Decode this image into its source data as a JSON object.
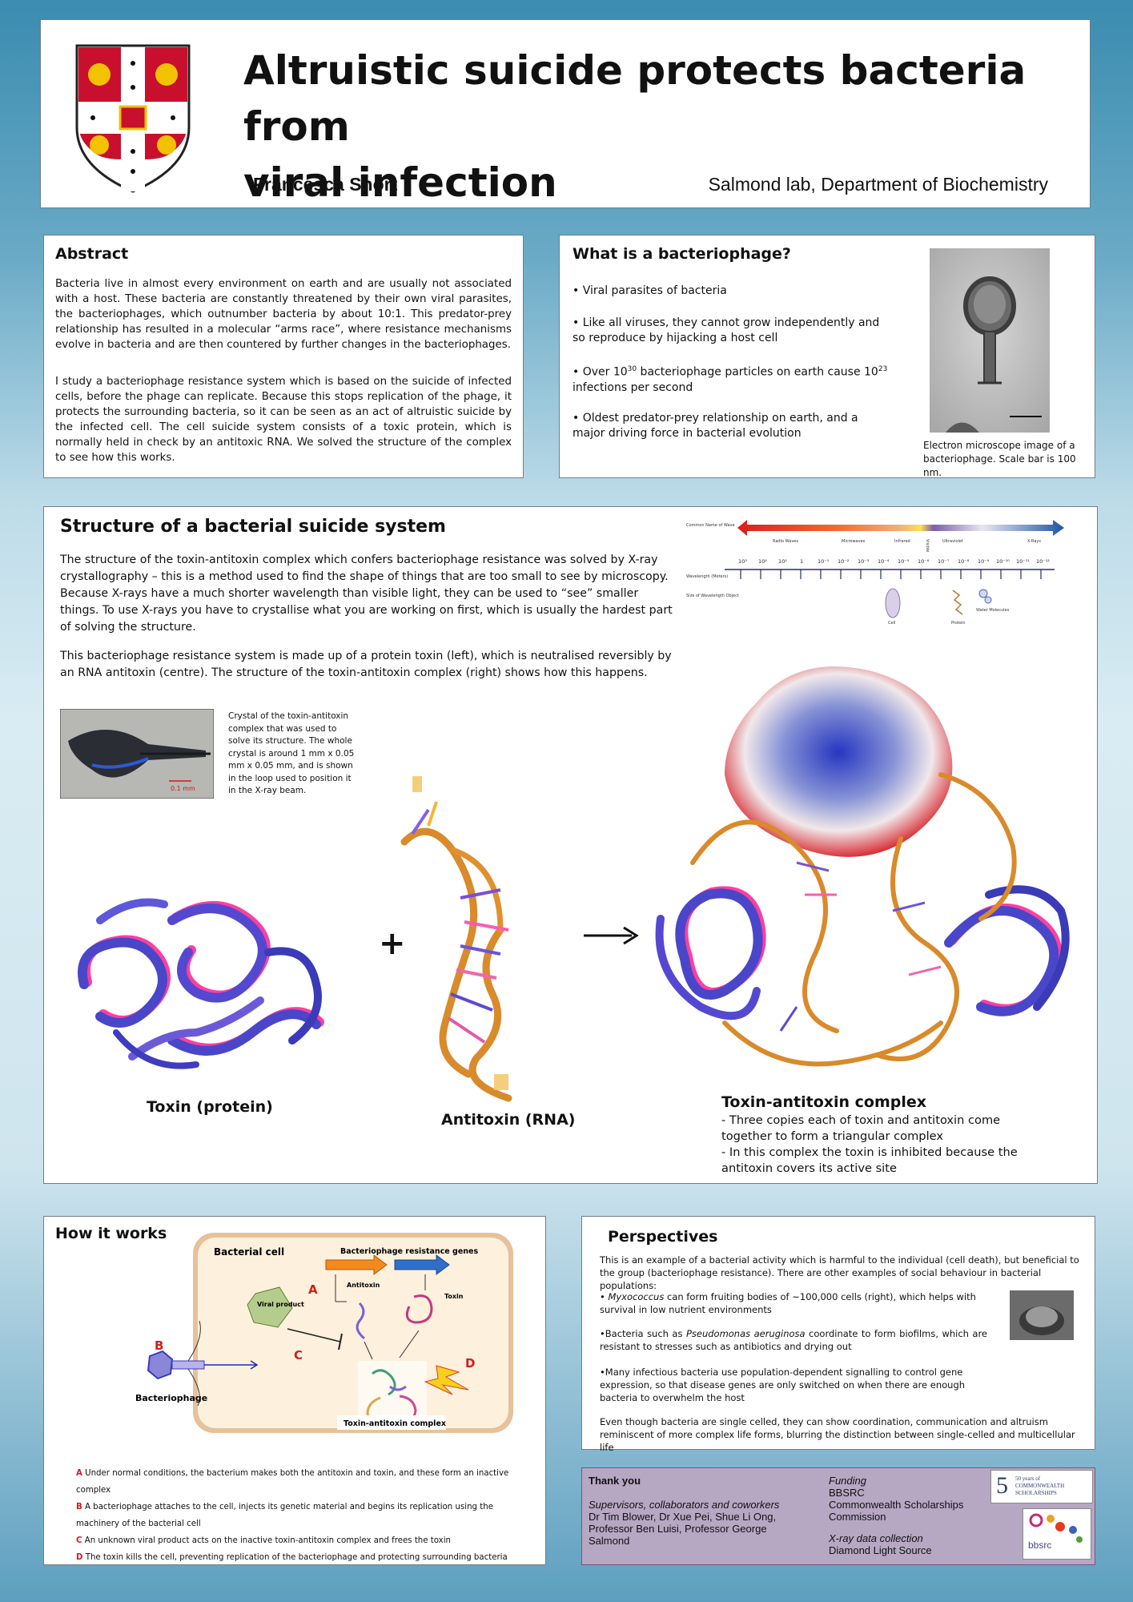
{
  "header": {
    "title_line1": "Altruistic suicide protects bacteria from",
    "title_line2": "viral infection",
    "author": "Francesca Short",
    "affiliation": "Salmond lab, Department of Biochemistry"
  },
  "abstract": {
    "heading": "Abstract",
    "p1": "Bacteria live in almost every environment on earth and are usually not associated with a host. These bacteria are constantly threatened by their own viral parasites, the bacteriophages, which outnumber bacteria by about 10:1. This predator-prey relationship has resulted in a molecular “arms race”, where resistance mechanisms evolve in bacteria and are then countered by further changes in the bacteriophages.",
    "p2": "I study a bacteriophage resistance system which is based on the suicide of infected cells, before the phage can replicate. Because this stops replication of the phage, it protects the surrounding bacteria, so it can be seen as an act of altruistic suicide by the infected cell. The cell suicide system consists of a toxic protein, which is normally held in check by an antitoxic RNA. We solved the structure of the complex to see how this works."
  },
  "phage": {
    "heading": "What is a bacteriophage?",
    "b1": "• Viral parasites of bacteria",
    "b2": "• Like all viruses, they cannot grow independently and so reproduce by hijacking a host cell",
    "b3_pre": "• Over 10",
    "b3_sup1": "30",
    "b3_mid": " bacteriophage particles on earth cause 10",
    "b3_sup2": "23",
    "b3_post": " infections per second",
    "b4": "• Oldest predator-prey relationship on earth, and a major driving force in bacterial evolution",
    "caption": "Electron microscope image of a bacteriophage. Scale bar is 100 nm."
  },
  "structure": {
    "heading": "Structure of a bacterial suicide system",
    "p1": "The structure of the toxin-antitoxin complex which confers bacteriophage resistance was solved by X-ray crystallography – this is a method used to find the shape of things that are too small to see by microscopy. Because X-rays have a much shorter wavelength than visible light, they can be used to “see” smaller things. To use X-rays you have to crystallise what you are working on first, which is usually the hardest part of solving the structure.",
    "p2": "This bacteriophage resistance system is made up of a protein toxin (left), which is neutralised reversibly by an RNA antitoxin (centre). The structure of the toxin-antitoxin complex (right) shows how this happens.",
    "crystal_caption": "Crystal of the toxin-antitoxin complex that was used to solve its structure. The whole crystal is around 1 mm x 0.05 mm x 0.05 mm, and is shown in the loop used to position it in the X-ray beam.",
    "crystal_scale": "0.1 mm",
    "toxin_label": "Toxin (protein)",
    "antitoxin_label": "Antitoxin (RNA)",
    "plus": "+",
    "complex_label": "Toxin-antitoxin complex",
    "complex_b1": "- Three copies each of toxin and antitoxin come together to form a triangular complex",
    "complex_b2": "- In this complex the toxin is inhibited because the antitoxin covers its active site",
    "spectrum": {
      "row1": "Common Name of Wave",
      "row2": "Wavelength (Meters)",
      "row3": "Size of Wavelength Object",
      "bands": [
        "Radio Waves",
        "Microwaves",
        "Infrared",
        "Visible",
        "Ultraviolet",
        "X-Rays"
      ],
      "ticks": [
        "10³",
        "10²",
        "10¹",
        "1",
        "10⁻¹",
        "10⁻²",
        "10⁻³",
        "10⁻⁴",
        "10⁻⁵",
        "10⁻⁶",
        "10⁻⁷",
        "10⁻⁸",
        "10⁻⁹",
        "10⁻¹⁰",
        "10⁻¹¹",
        "10⁻¹²"
      ],
      "objects": [
        "Cell",
        "Protein",
        "Water Molecules"
      ]
    }
  },
  "how": {
    "heading": "How it works",
    "cell_label": "Bacterial cell",
    "genes_label": "Bacteriophage resistance genes",
    "antitoxin": "Antitoxin",
    "toxin": "Toxin",
    "viral_product": "Viral product",
    "complex": "Toxin-antitoxin complex",
    "phage": "Bacteriophage",
    "letters": [
      "A",
      "B",
      "C",
      "D"
    ],
    "steps": [
      {
        "letter": "A",
        "text": "Under normal conditions, the bacterium makes both the antitoxin and toxin, and these form an inactive complex"
      },
      {
        "letter": "B",
        "text": "A bacteriophage attaches to the cell, injects its genetic material and begins its replication using the machinery of the bacterial cell"
      },
      {
        "letter": "C",
        "text": "An unknown viral product acts on the inactive toxin-antitoxin complex and frees the toxin"
      },
      {
        "letter": "D",
        "text": "The toxin kills the cell, preventing replication of the bacteriophage and protecting surrounding bacteria"
      }
    ]
  },
  "perspectives": {
    "heading": "Perspectives",
    "intro": "This is an example of a bacterial activity which is harmful to the individual (cell death), but beneficial to the group (bacteriophage resistance). There are other examples of social behaviour in bacterial populations:",
    "b1_pre": "• ",
    "b1_italic": "Myxococcus",
    "b1_post": " can form fruiting bodies of ~100,000 cells (right), which helps with survival in low nutrient environments",
    "b2_pre": "•Bacteria such as ",
    "b2_italic": "Pseudomonas aeruginosa",
    "b2_post": " coordinate to form biofilms, which are resistant to stresses such as antibiotics and drying out",
    "b3": "•Many infectious bacteria use population-dependent signalling to control gene expression, so that disease genes are only switched on when there are enough bacteria to overwhelm the host",
    "closing": "Even though bacteria are single celled, they can show coordination, communication and altruism reminiscent of more complex life forms, blurring the distinction between single-celled and multicellular life"
  },
  "thanks": {
    "heading": "Thank you",
    "sub1": "Supervisors, collaborators and coworkers",
    "names": "Dr Tim Blower, Dr Xue Pei, Shue Li Ong, Professor Ben Luisi, Professor George Salmond",
    "funding": "Funding",
    "f1": "BBSRC",
    "f2": "Commonwealth Scholarships Commission",
    "xray": "X-ray data collection",
    "xray_src": "Diamond Light Source",
    "logo1": "50 years of COMMONWEALTH SCHOLARSHIPS",
    "logo2": "bbsrc"
  }
}
